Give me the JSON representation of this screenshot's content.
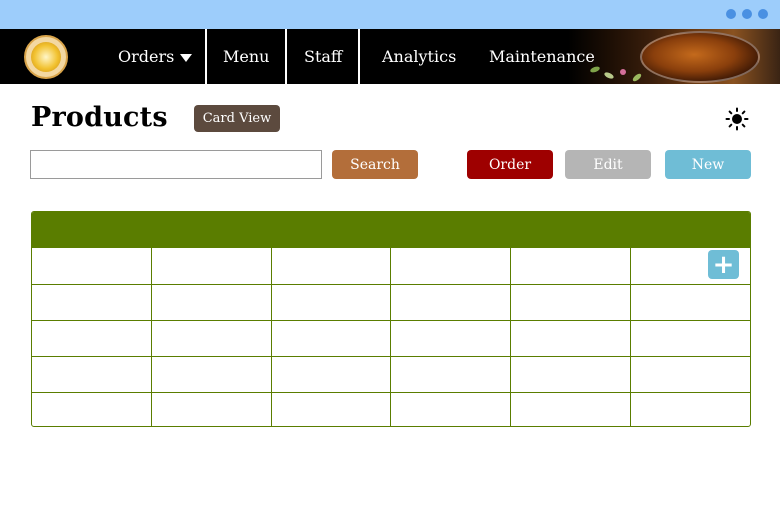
{
  "nav": {
    "items": [
      {
        "label": "Orders",
        "has_dropdown": true
      },
      {
        "label": "Menu"
      },
      {
        "label": "Staff"
      },
      {
        "label": "Analytics"
      },
      {
        "label": "Maintenance"
      }
    ],
    "logo_icon": "lemon-logo-icon"
  },
  "header": {
    "title": "Products",
    "card_view_label": "Card View",
    "theme_icon": "sun-icon"
  },
  "toolbar": {
    "search_value": "",
    "search_placeholder": "",
    "search_label": "Search",
    "order_label": "Order",
    "edit_label": "Edit",
    "new_label": "New"
  },
  "table": {
    "columns": 6,
    "rows": [
      [
        "",
        "",
        "",
        "",
        "",
        ""
      ],
      [
        "",
        "",
        "",
        "",
        "",
        ""
      ],
      [
        "",
        "",
        "",
        "",
        "",
        ""
      ],
      [
        "",
        "",
        "",
        "",
        "",
        ""
      ],
      [
        "",
        "",
        "",
        "",
        "",
        ""
      ]
    ],
    "add_label": "+"
  },
  "colors": {
    "chrome": "#9dcdfb",
    "nav_bg": "#000000",
    "table_header": "#5a7d00",
    "search_button": "#b36e3a",
    "order_button": "#9e0000",
    "edit_button": "#b5b5b5",
    "new_button": "#6fbdd6",
    "card_view_button": "#5c4a3e"
  }
}
